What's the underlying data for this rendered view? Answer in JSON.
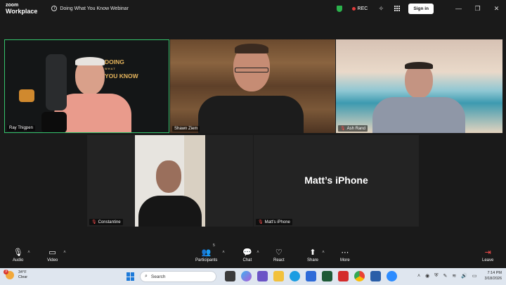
{
  "titlebar": {
    "logo_line1": "zoom",
    "logo_line2": "Workplace",
    "meeting_title": "Doing What You Know Webinar",
    "rec_label": "REC",
    "sign_in": "Sign in"
  },
  "tiles": {
    "ray": {
      "name": "Ray Thigpen",
      "brand_line1": "DOING",
      "brand_small": "WHAT",
      "brand_line2": "YOU KNOW"
    },
    "shawn": {
      "name": "Shawn Ziem"
    },
    "ash": {
      "name": "Ash Rand"
    },
    "constantine": {
      "name": "Constantine"
    },
    "matt": {
      "name": "Matt’s iPhone",
      "big_label": "Matt’s iPhone"
    }
  },
  "toolbar": {
    "audio": "Audio",
    "video": "Video",
    "participants": "Participants",
    "participants_count": "5",
    "chat": "Chat",
    "react": "React",
    "share": "Share",
    "more": "More",
    "leave": "Leave"
  },
  "taskbar": {
    "weather_temp": "34°F",
    "weather_desc": "Clear",
    "weather_badge": "3",
    "search_placeholder": "Search",
    "time": "7:14 PM",
    "date": "3/18/2026"
  },
  "colors": {
    "active_speaker_border": "#36c46d",
    "rec_dot": "#e03b3b",
    "leave": "#ff4d4d",
    "shield": "#2bb24c"
  }
}
